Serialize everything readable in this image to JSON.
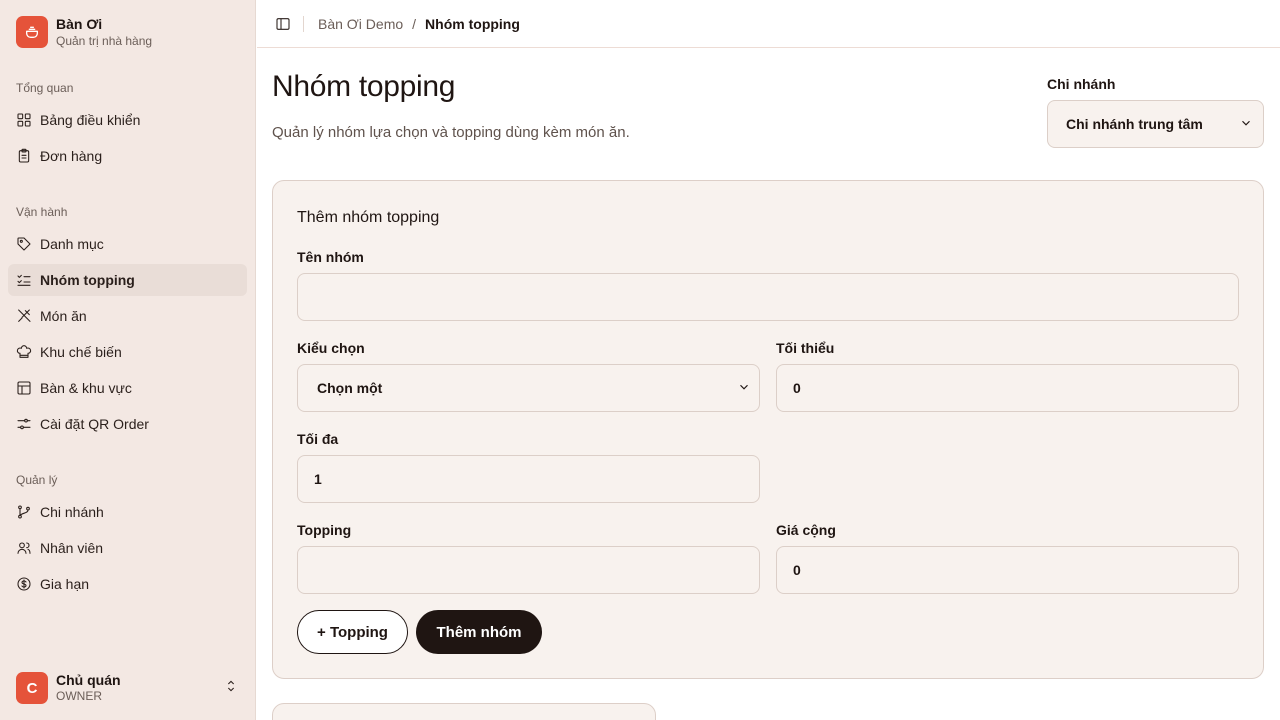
{
  "brand": {
    "name": "Bàn Ơi",
    "subtitle": "Quản trị nhà hàng"
  },
  "sidebar": {
    "sections": [
      {
        "label": "Tổng quan",
        "items": [
          {
            "label": "Bảng điều khiển",
            "icon": "grid-icon"
          },
          {
            "label": "Đơn hàng",
            "icon": "clipboard-icon"
          }
        ]
      },
      {
        "label": "Vận hành",
        "items": [
          {
            "label": "Danh mục",
            "icon": "tag-icon"
          },
          {
            "label": "Nhóm topping",
            "icon": "list-check-icon",
            "active": true
          },
          {
            "label": "Món ăn",
            "icon": "utensils-icon"
          },
          {
            "label": "Khu chế biến",
            "icon": "chef-hat-icon"
          },
          {
            "label": "Bàn & khu vực",
            "icon": "table-icon"
          },
          {
            "label": "Cài đặt QR Order",
            "icon": "sliders-icon"
          }
        ]
      },
      {
        "label": "Quản lý",
        "items": [
          {
            "label": "Chi nhánh",
            "icon": "git-branch-icon"
          },
          {
            "label": "Nhân viên",
            "icon": "users-icon"
          },
          {
            "label": "Gia hạn",
            "icon": "dollar-circle-icon"
          }
        ]
      }
    ]
  },
  "user": {
    "initial": "C",
    "name": "Chủ quán",
    "role": "OWNER"
  },
  "breadcrumb": {
    "parent": "Bàn Ơi Demo",
    "separator": "/",
    "current": "Nhóm topping"
  },
  "page": {
    "title": "Nhóm topping",
    "description": "Quản lý nhóm lựa chọn và topping dùng kèm món ăn."
  },
  "branch": {
    "label": "Chi nhánh",
    "selected": "Chi nhánh trung tâm"
  },
  "form": {
    "title": "Thêm nhóm topping",
    "group_name": {
      "label": "Tên nhóm",
      "value": ""
    },
    "select_type": {
      "label": "Kiểu chọn",
      "selected": "Chọn một"
    },
    "minimum": {
      "label": "Tối thiểu",
      "value": "0"
    },
    "maximum": {
      "label": "Tối đa",
      "value": "1"
    },
    "topping": {
      "label": "Topping",
      "value": ""
    },
    "extra_price": {
      "label": "Giá cộng",
      "value": "0"
    },
    "add_topping_label": "+ Topping",
    "add_group_label": "Thêm nhóm"
  },
  "colors": {
    "accent": "#e5533a",
    "dark": "#1f1512",
    "sidebar_bg": "#f3e8e3",
    "card_bg": "#f8f2ee"
  }
}
